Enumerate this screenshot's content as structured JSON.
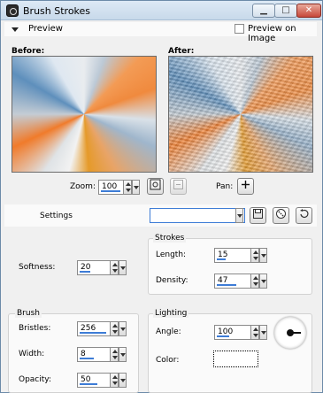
{
  "window": {
    "title": "Brush Strokes",
    "minimize_label": "▁",
    "maximize_label": "□",
    "close_label": "✕"
  },
  "preview": {
    "header_label": "Preview",
    "preview_on_image_label": "Preview on Image",
    "preview_on_image_checked": false,
    "before_label": "Before:",
    "after_label": "After:"
  },
  "view": {
    "zoom_label": "Zoom:",
    "zoom_value": "100",
    "pan_label": "Pan:",
    "zoom_fit_icon": "zoom-to-fit-icon",
    "actual_size_icon": "actual-size-icon",
    "pan_icon": "move-crosshair-icon"
  },
  "settings": {
    "label": "Settings",
    "preset_value": "",
    "save_preset_icon": "save-icon",
    "randomize_icon": "dice-icon",
    "reset_icon": "reset-icon"
  },
  "params": {
    "softness_label": "Softness:",
    "softness_value": "20",
    "strokes_group": "Strokes",
    "length_label": "Length:",
    "length_value": "15",
    "density_label": "Density:",
    "density_value": "47",
    "brush_group": "Brush",
    "bristles_label": "Bristles:",
    "bristles_value": "256",
    "width_label": "Width:",
    "width_value": "8",
    "opacity_label": "Opacity:",
    "opacity_value": "50",
    "lighting_group": "Lighting",
    "angle_label": "Angle:",
    "angle_value": "100",
    "color_label": "Color:",
    "color_hex": "#ffffff"
  }
}
